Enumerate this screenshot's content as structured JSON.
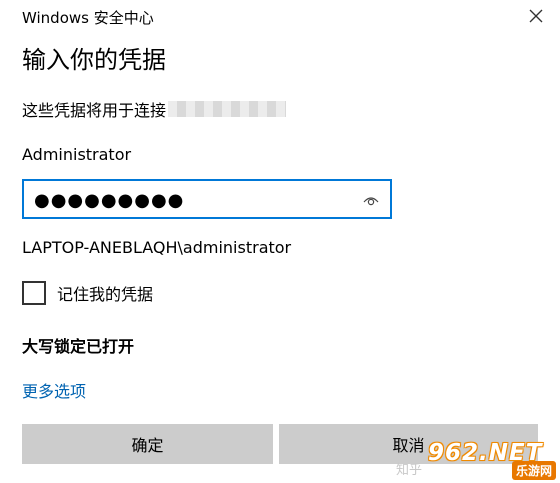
{
  "window": {
    "app_title": "Windows 安全中心"
  },
  "dialog": {
    "heading": "输入你的凭据",
    "subtitle": "这些凭据将用于连接"
  },
  "credentials": {
    "username": "Administrator",
    "password_masked": "●●●●●●●●●",
    "domain_user": "LAPTOP-ANEBLAQH\\administrator"
  },
  "remember": {
    "label": "记住我的凭据",
    "checked": false
  },
  "caps_lock_warning": "大写锁定已打开",
  "more_options": "更多选项",
  "buttons": {
    "ok": "确定",
    "cancel": "取消"
  },
  "watermark": {
    "zhihu": "知乎",
    "logo": "962.NET",
    "sub": "乐游网"
  },
  "colors": {
    "accent": "#0078d7",
    "link": "#0063b1",
    "button_bg": "#cccccc"
  },
  "icons": {
    "close": "close-icon",
    "reveal": "eye-icon"
  }
}
